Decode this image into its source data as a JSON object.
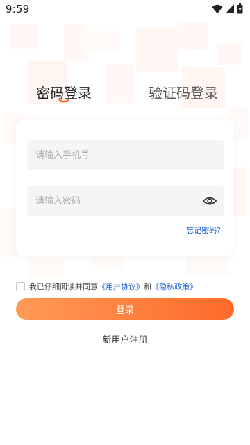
{
  "status_bar": {
    "time": "9:59",
    "icons": [
      "wifi-icon",
      "signal-icon",
      "battery-icon"
    ]
  },
  "tabs": [
    {
      "label": "密码登录",
      "active": true
    },
    {
      "label": "验证码登录",
      "active": false
    }
  ],
  "form": {
    "phone": {
      "placeholder": "请输入手机号",
      "value": ""
    },
    "password": {
      "placeholder": "请输入密码",
      "value": ""
    },
    "password_toggle_icon": "eye-icon",
    "forgot_label": "忘记密码?"
  },
  "agreement": {
    "checked": false,
    "prefix": "我已仔细阅读并同意",
    "user_agreement": "《用户协议》",
    "conjunction": "和",
    "privacy_policy": "《隐私政策》"
  },
  "login_button": "登录",
  "register_link": "新用户注册",
  "colors": {
    "accent_start": "#ff9a56",
    "accent_end": "#ff6a2a",
    "link": "#1a5fd6",
    "input_bg": "#f4f5f7"
  }
}
